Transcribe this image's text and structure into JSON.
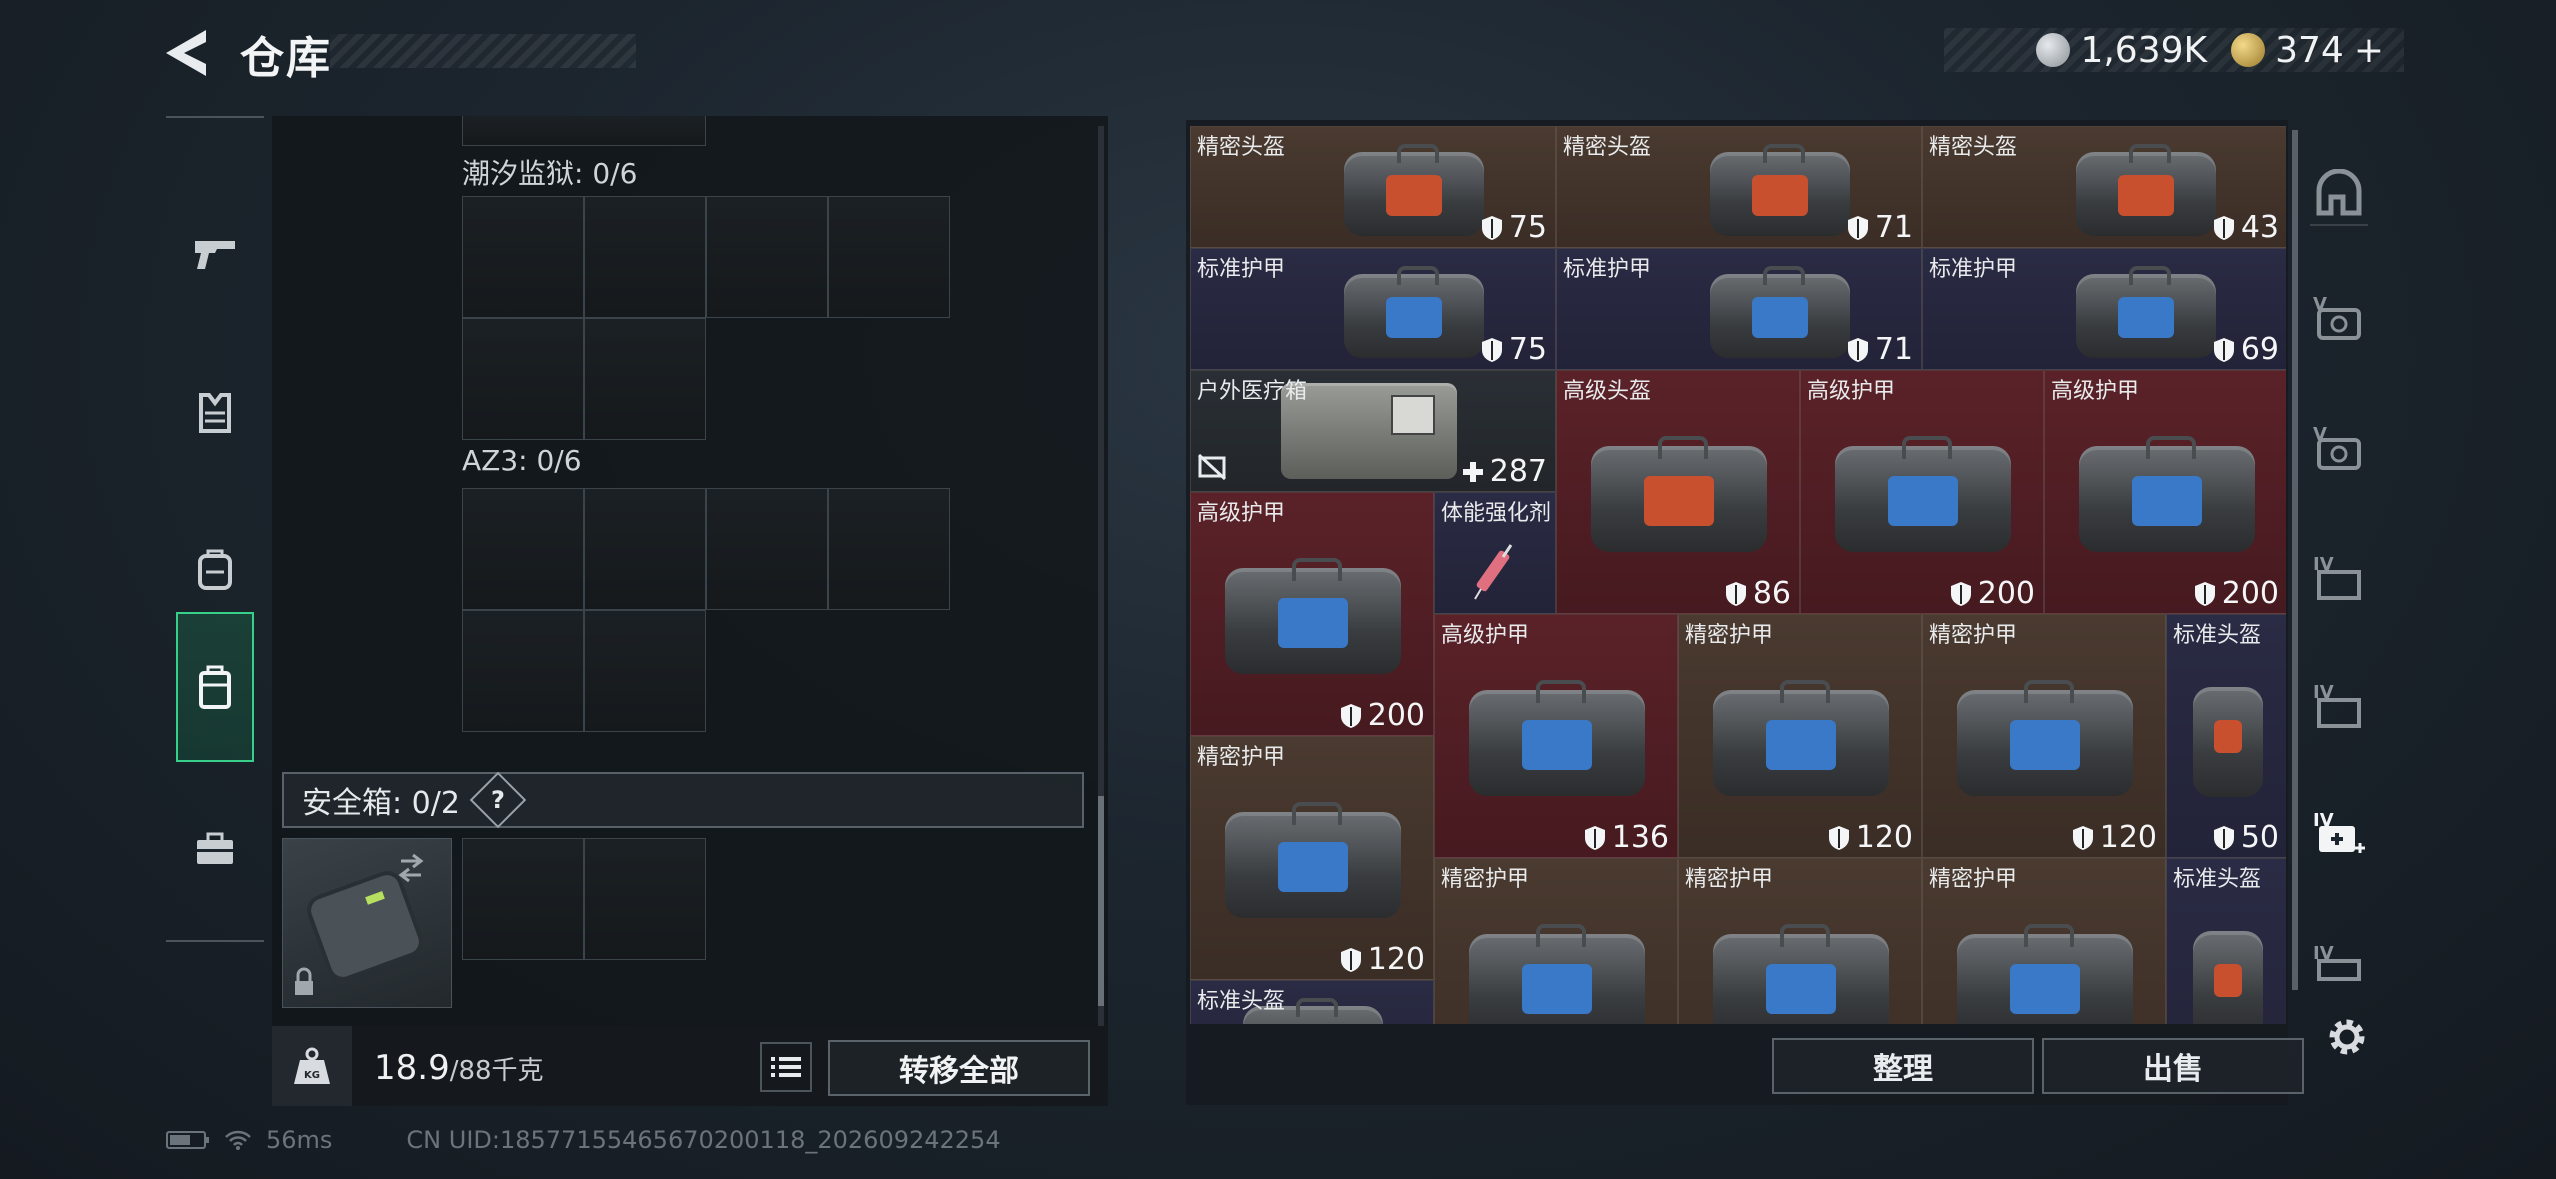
{
  "header": {
    "title": "仓库"
  },
  "currency": {
    "silver": "1,639K",
    "gold": "374",
    "gold_plus": "+"
  },
  "left_nav": [
    "weapon-icon",
    "vest-icon",
    "backpack-icon",
    "container-icon",
    "toolbox-icon"
  ],
  "left_panel": {
    "grid1_label": "潮汐监狱: 0/6",
    "grid2_label": "AZ3: 0/6",
    "safe_label": "安全箱: 0/2",
    "safe_help": "?"
  },
  "weight": {
    "current": "18.9",
    "max": "/88千克"
  },
  "buttons": {
    "transfer_all": "转移全部",
    "tidy": "整理",
    "sell": "出售"
  },
  "items": [
    {
      "name": "精密头盔",
      "value": "75",
      "style": "brown",
      "kind": "helmet"
    },
    {
      "name": "精密头盔",
      "value": "71",
      "style": "brown",
      "kind": "helmet"
    },
    {
      "name": "精密头盔",
      "value": "43",
      "style": "brown",
      "kind": "helmet"
    },
    {
      "name": "标准护甲",
      "value": "75",
      "style": "navy",
      "kind": "armor"
    },
    {
      "name": "标准护甲",
      "value": "71",
      "style": "navy",
      "kind": "armor"
    },
    {
      "name": "标准护甲",
      "value": "69",
      "style": "navy",
      "kind": "armor"
    },
    {
      "name": "户外医疗箱",
      "value": "287",
      "style": "dark",
      "kind": "medkit"
    },
    {
      "name": "高级头盔",
      "value": "86",
      "style": "red",
      "kind": "helmet"
    },
    {
      "name": "高级护甲",
      "value": "200",
      "style": "red",
      "kind": "armor"
    },
    {
      "name": "高级护甲",
      "value": "200",
      "style": "red",
      "kind": "armor"
    },
    {
      "name": "高级护甲",
      "value": "200",
      "style": "red",
      "kind": "armor"
    },
    {
      "name": "体能强化剂",
      "value": "",
      "style": "navy",
      "kind": "syringe"
    },
    {
      "name": "高级护甲",
      "value": "136",
      "style": "red",
      "kind": "armor"
    },
    {
      "name": "精密护甲",
      "value": "120",
      "style": "brown",
      "kind": "armor"
    },
    {
      "name": "精密护甲",
      "value": "120",
      "style": "brown",
      "kind": "armor"
    },
    {
      "name": "标准头盔",
      "value": "50",
      "style": "navy",
      "kind": "helmet-small"
    },
    {
      "name": "精密护甲",
      "value": "120",
      "style": "brown",
      "kind": "armor"
    },
    {
      "name": "精密护甲",
      "value": "",
      "style": "brown",
      "kind": "armor"
    },
    {
      "name": "精密护甲",
      "value": "",
      "style": "brown",
      "kind": "armor"
    },
    {
      "name": "精密护甲",
      "value": "",
      "style": "brown",
      "kind": "armor"
    },
    {
      "name": "标准头盔",
      "value": "",
      "style": "navy",
      "kind": "helmet-small"
    },
    {
      "name": "标准头盔",
      "value": "",
      "style": "navy",
      "kind": "helmet"
    }
  ],
  "right_nav": [
    "helmet-slot-icon",
    "armor-v-icon",
    "armor-v-icon",
    "box-iv-icon",
    "box-iv-icon",
    "medkit-iv-icon",
    "box-iv-icon"
  ],
  "footer": {
    "ping": "56ms",
    "uid": "CN UID:18577155465670200118_202609242254"
  }
}
